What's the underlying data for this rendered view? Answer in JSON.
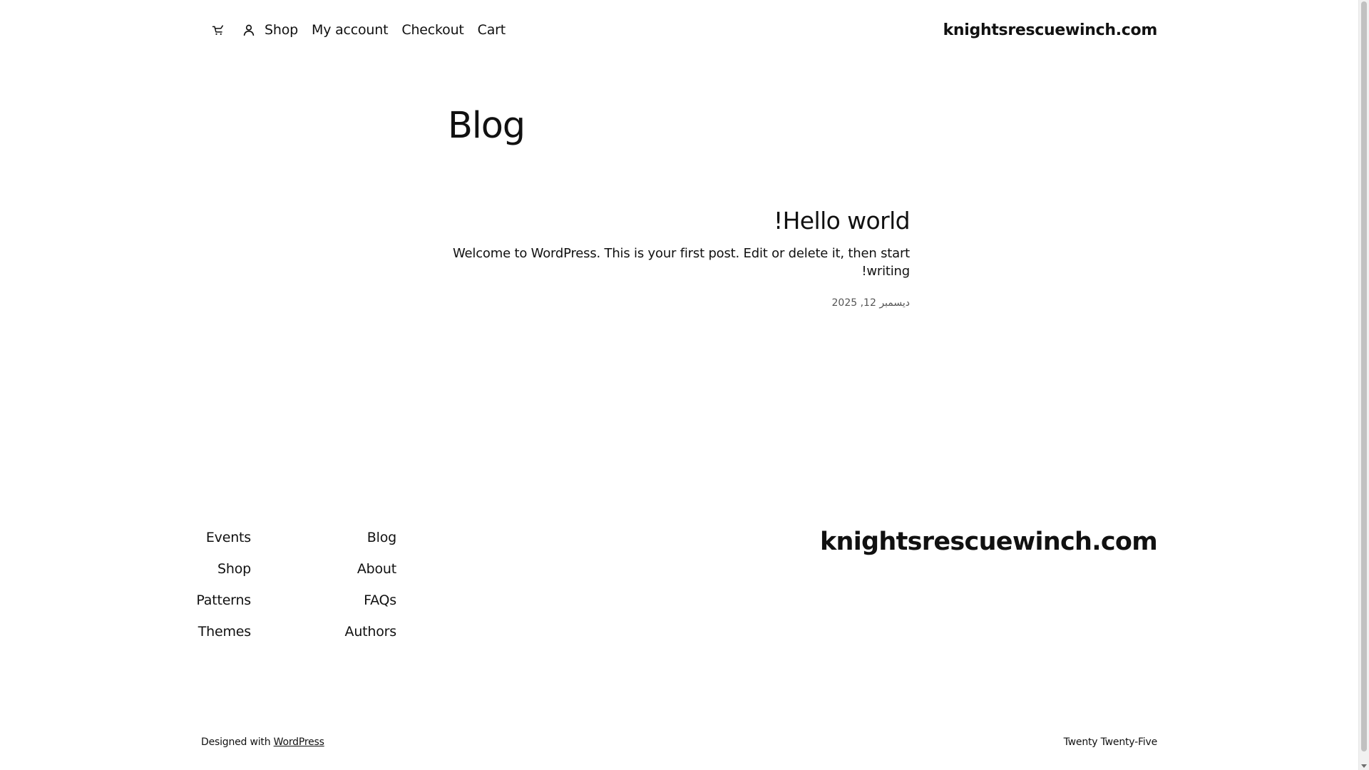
{
  "header": {
    "site_title": "knightsrescuewinch.com",
    "cart_icon": "cart-icon",
    "account_icon": "user-icon",
    "nav": [
      {
        "label": "Shop"
      },
      {
        "label": "My account"
      },
      {
        "label": "Checkout"
      },
      {
        "label": "Cart"
      }
    ]
  },
  "main": {
    "page_title": "Blog",
    "posts": [
      {
        "title": "Hello world!",
        "excerpt": "Welcome to WordPress. This is your first post. Edit or delete it, then start writing!",
        "date": "ديسمبر 12, 2025"
      }
    ]
  },
  "footer": {
    "site_title": "knightsrescuewinch.com",
    "nav_col_1": [
      {
        "label": "Events"
      },
      {
        "label": "Shop"
      },
      {
        "label": "Patterns"
      },
      {
        "label": "Themes"
      }
    ],
    "nav_col_2": [
      {
        "label": "Blog"
      },
      {
        "label": "About"
      },
      {
        "label": "FAQs"
      },
      {
        "label": "Authors"
      }
    ],
    "credits_prefix": "Designed with ",
    "credits_link": "WordPress",
    "theme_name": "Twenty Twenty-Five"
  }
}
